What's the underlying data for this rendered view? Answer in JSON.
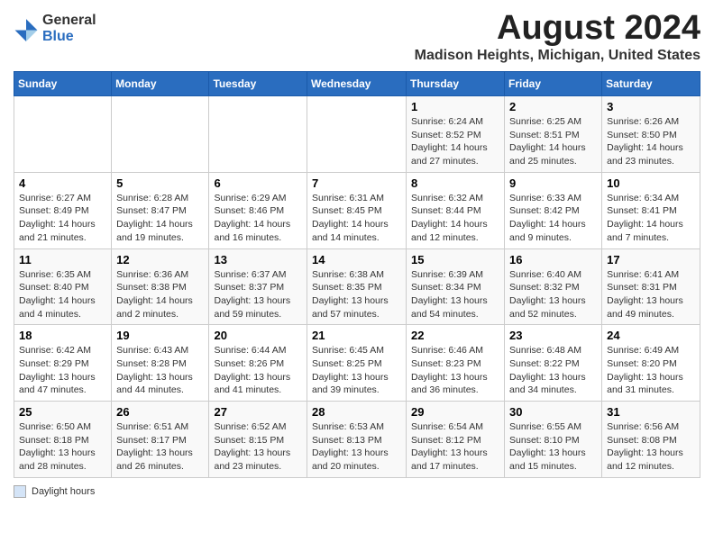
{
  "logo": {
    "general": "General",
    "blue": "Blue"
  },
  "title": "August 2024",
  "location": "Madison Heights, Michigan, United States",
  "days_of_week": [
    "Sunday",
    "Monday",
    "Tuesday",
    "Wednesday",
    "Thursday",
    "Friday",
    "Saturday"
  ],
  "footer_label": "Daylight hours",
  "weeks": [
    [
      {
        "day": "",
        "info": ""
      },
      {
        "day": "",
        "info": ""
      },
      {
        "day": "",
        "info": ""
      },
      {
        "day": "",
        "info": ""
      },
      {
        "day": "1",
        "info": "Sunrise: 6:24 AM\nSunset: 8:52 PM\nDaylight: 14 hours and 27 minutes."
      },
      {
        "day": "2",
        "info": "Sunrise: 6:25 AM\nSunset: 8:51 PM\nDaylight: 14 hours and 25 minutes."
      },
      {
        "day": "3",
        "info": "Sunrise: 6:26 AM\nSunset: 8:50 PM\nDaylight: 14 hours and 23 minutes."
      }
    ],
    [
      {
        "day": "4",
        "info": "Sunrise: 6:27 AM\nSunset: 8:49 PM\nDaylight: 14 hours and 21 minutes."
      },
      {
        "day": "5",
        "info": "Sunrise: 6:28 AM\nSunset: 8:47 PM\nDaylight: 14 hours and 19 minutes."
      },
      {
        "day": "6",
        "info": "Sunrise: 6:29 AM\nSunset: 8:46 PM\nDaylight: 14 hours and 16 minutes."
      },
      {
        "day": "7",
        "info": "Sunrise: 6:31 AM\nSunset: 8:45 PM\nDaylight: 14 hours and 14 minutes."
      },
      {
        "day": "8",
        "info": "Sunrise: 6:32 AM\nSunset: 8:44 PM\nDaylight: 14 hours and 12 minutes."
      },
      {
        "day": "9",
        "info": "Sunrise: 6:33 AM\nSunset: 8:42 PM\nDaylight: 14 hours and 9 minutes."
      },
      {
        "day": "10",
        "info": "Sunrise: 6:34 AM\nSunset: 8:41 PM\nDaylight: 14 hours and 7 minutes."
      }
    ],
    [
      {
        "day": "11",
        "info": "Sunrise: 6:35 AM\nSunset: 8:40 PM\nDaylight: 14 hours and 4 minutes."
      },
      {
        "day": "12",
        "info": "Sunrise: 6:36 AM\nSunset: 8:38 PM\nDaylight: 14 hours and 2 minutes."
      },
      {
        "day": "13",
        "info": "Sunrise: 6:37 AM\nSunset: 8:37 PM\nDaylight: 13 hours and 59 minutes."
      },
      {
        "day": "14",
        "info": "Sunrise: 6:38 AM\nSunset: 8:35 PM\nDaylight: 13 hours and 57 minutes."
      },
      {
        "day": "15",
        "info": "Sunrise: 6:39 AM\nSunset: 8:34 PM\nDaylight: 13 hours and 54 minutes."
      },
      {
        "day": "16",
        "info": "Sunrise: 6:40 AM\nSunset: 8:32 PM\nDaylight: 13 hours and 52 minutes."
      },
      {
        "day": "17",
        "info": "Sunrise: 6:41 AM\nSunset: 8:31 PM\nDaylight: 13 hours and 49 minutes."
      }
    ],
    [
      {
        "day": "18",
        "info": "Sunrise: 6:42 AM\nSunset: 8:29 PM\nDaylight: 13 hours and 47 minutes."
      },
      {
        "day": "19",
        "info": "Sunrise: 6:43 AM\nSunset: 8:28 PM\nDaylight: 13 hours and 44 minutes."
      },
      {
        "day": "20",
        "info": "Sunrise: 6:44 AM\nSunset: 8:26 PM\nDaylight: 13 hours and 41 minutes."
      },
      {
        "day": "21",
        "info": "Sunrise: 6:45 AM\nSunset: 8:25 PM\nDaylight: 13 hours and 39 minutes."
      },
      {
        "day": "22",
        "info": "Sunrise: 6:46 AM\nSunset: 8:23 PM\nDaylight: 13 hours and 36 minutes."
      },
      {
        "day": "23",
        "info": "Sunrise: 6:48 AM\nSunset: 8:22 PM\nDaylight: 13 hours and 34 minutes."
      },
      {
        "day": "24",
        "info": "Sunrise: 6:49 AM\nSunset: 8:20 PM\nDaylight: 13 hours and 31 minutes."
      }
    ],
    [
      {
        "day": "25",
        "info": "Sunrise: 6:50 AM\nSunset: 8:18 PM\nDaylight: 13 hours and 28 minutes."
      },
      {
        "day": "26",
        "info": "Sunrise: 6:51 AM\nSunset: 8:17 PM\nDaylight: 13 hours and 26 minutes."
      },
      {
        "day": "27",
        "info": "Sunrise: 6:52 AM\nSunset: 8:15 PM\nDaylight: 13 hours and 23 minutes."
      },
      {
        "day": "28",
        "info": "Sunrise: 6:53 AM\nSunset: 8:13 PM\nDaylight: 13 hours and 20 minutes."
      },
      {
        "day": "29",
        "info": "Sunrise: 6:54 AM\nSunset: 8:12 PM\nDaylight: 13 hours and 17 minutes."
      },
      {
        "day": "30",
        "info": "Sunrise: 6:55 AM\nSunset: 8:10 PM\nDaylight: 13 hours and 15 minutes."
      },
      {
        "day": "31",
        "info": "Sunrise: 6:56 AM\nSunset: 8:08 PM\nDaylight: 13 hours and 12 minutes."
      }
    ]
  ]
}
